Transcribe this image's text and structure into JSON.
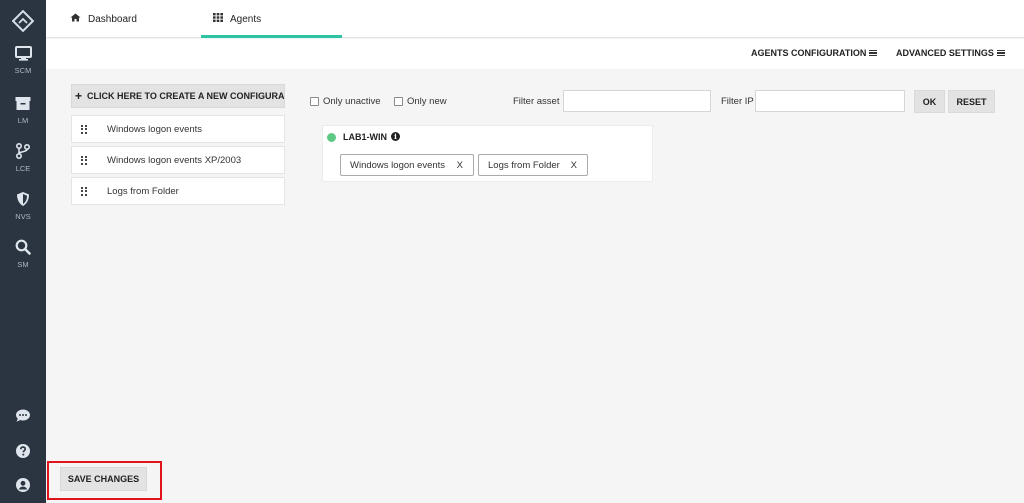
{
  "sidebar": {
    "items": [
      {
        "label": "SCM",
        "icon": "monitor-icon"
      },
      {
        "label": "LM",
        "icon": "archive-icon"
      },
      {
        "label": "LCE",
        "icon": "branch-icon"
      },
      {
        "label": "NVS",
        "icon": "shield-icon"
      },
      {
        "label": "SM",
        "icon": "search-icon"
      }
    ],
    "bottom_icons": [
      "chat-icon",
      "help-icon",
      "user-icon"
    ]
  },
  "tabs": [
    {
      "label": "Dashboard",
      "icon": "home-icon",
      "active": false
    },
    {
      "label": "Agents",
      "icon": "grid-icon",
      "active": true
    }
  ],
  "menu": {
    "agents_config": "AGENTS CONFIGURATION",
    "advanced_settings": "ADVANCED SETTINGS"
  },
  "create_button": "CLICK HERE TO CREATE A NEW CONFIGURATI",
  "configurations": [
    {
      "label": "Windows logon events"
    },
    {
      "label": "Windows logon events XP/2003"
    },
    {
      "label": "Logs from Folder"
    }
  ],
  "filters": {
    "only_unactive": "Only unactive",
    "only_new": "Only new",
    "filter_asset_label": "Filter asset",
    "filter_asset_value": "",
    "filter_ip_label": "Filter IP",
    "filter_ip_value": "",
    "ok": "OK",
    "reset": "RESET"
  },
  "agent": {
    "name": "LAB1-WIN",
    "status_color": "#5ec985",
    "configs": [
      {
        "label": "Windows logon events",
        "remove": "X"
      },
      {
        "label": "Logs from Folder",
        "remove": "X"
      }
    ]
  },
  "save_button": "SAVE CHANGES",
  "colors": {
    "sidebar_bg": "#2b3542",
    "tab_accent": "#2ec4a3",
    "highlight": "#e2141b"
  }
}
